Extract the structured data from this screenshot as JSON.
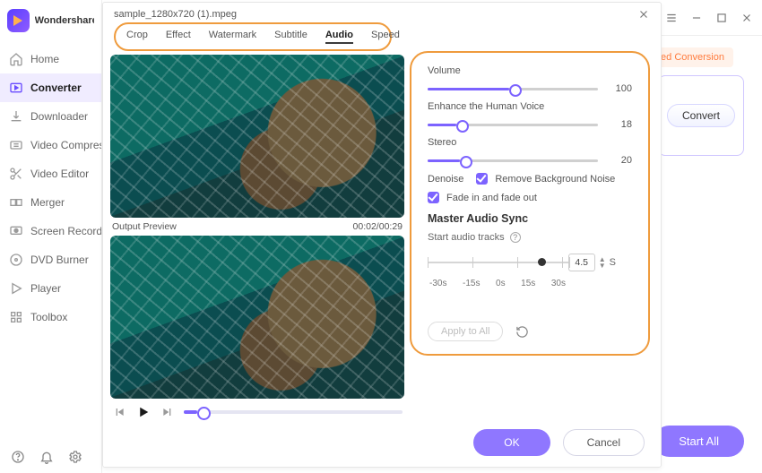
{
  "app": {
    "brand": "Wondershare"
  },
  "sidebar": {
    "items": [
      {
        "label": "Home"
      },
      {
        "label": "Converter"
      },
      {
        "label": "Downloader"
      },
      {
        "label": "Video Compressor"
      },
      {
        "label": "Video Editor"
      },
      {
        "label": "Merger"
      },
      {
        "label": "Screen Recorder"
      },
      {
        "label": "DVD Burner"
      },
      {
        "label": "Player"
      },
      {
        "label": "Toolbox"
      }
    ]
  },
  "back": {
    "pill": "Speed Conversion",
    "convert": "Convert",
    "startall": "Start All"
  },
  "modal": {
    "title": "sample_1280x720 (1).mpeg",
    "tabs": [
      "Crop",
      "Effect",
      "Watermark",
      "Subtitle",
      "Audio",
      "Speed"
    ],
    "active_tab_index": 4,
    "preview_label": "Output Preview",
    "preview_time": "00:02/00:29",
    "panel": {
      "volume_label": "Volume",
      "volume_value": "100",
      "enhance_label": "Enhance the Human Voice",
      "enhance_value": "18",
      "stereo_label": "Stereo",
      "stereo_value": "20",
      "denoise_label": "Denoise",
      "denoise_check_label": "Remove Background Noise",
      "fade_label": "Fade in and fade out",
      "master_title": "Master Audio Sync",
      "master_sub": "Start audio tracks",
      "sync_ticks": [
        "-30s",
        "-15s",
        "0s",
        "15s",
        "30s"
      ],
      "sync_value": "4.5",
      "sync_unit": "S",
      "apply_label": "Apply to All"
    },
    "ok": "OK",
    "cancel": "Cancel"
  }
}
